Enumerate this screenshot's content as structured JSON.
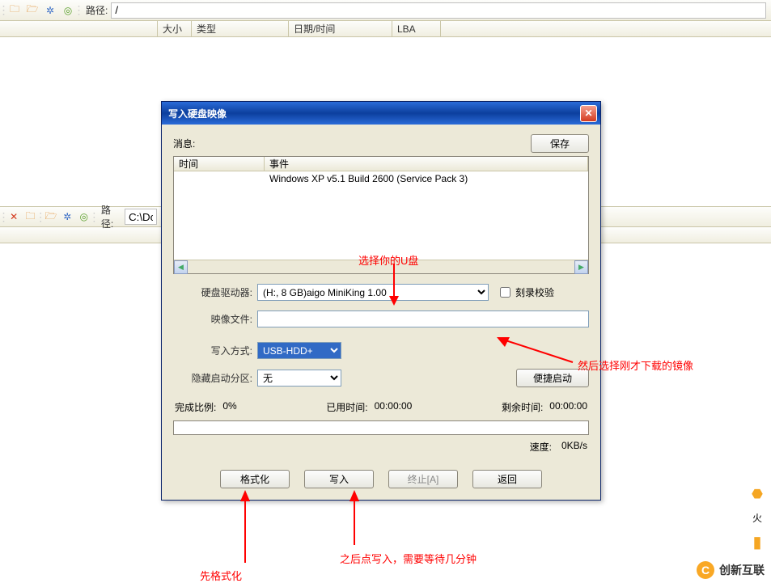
{
  "toolbar_top": {
    "path_label": "路径:",
    "path_value": "/"
  },
  "columns": {
    "c1_width": 195,
    "c1": "",
    "c2": "大小",
    "c3": "类型",
    "c4": "日期/时间",
    "c5": "LBA"
  },
  "toolbar2": {
    "path_label": "路径:",
    "path_value": "C:\\Doc"
  },
  "dialog": {
    "title": "写入硬盘映像",
    "msg_label": "消息:",
    "save_btn": "保存",
    "msg_cols": {
      "time": "时间",
      "event": "事件"
    },
    "msg_event": "Windows XP v5.1 Build 2600 (Service Pack 3)",
    "drive_label": "硬盘驱动器:",
    "drive_value": "(H:, 8 GB)aigo      MiniKing       1.00",
    "verify_label": "刻录校验",
    "image_label": "映像文件:",
    "image_value": "",
    "write_mode_label": "写入方式:",
    "write_mode_value": "USB-HDD+",
    "hidden_boot_label": "隐藏启动分区:",
    "hidden_boot_value": "无",
    "quick_boot_btn": "便捷启动",
    "percent_label": "完成比例:",
    "percent_value": "0%",
    "elapsed_label": "已用时间:",
    "elapsed_value": "00:00:00",
    "remaining_label": "剩余时间:",
    "remaining_value": "00:00:00",
    "speed_label": "速度:",
    "speed_value": "0KB/s",
    "format_btn": "格式化",
    "write_btn": "写入",
    "stop_btn": "终止[A]",
    "back_btn": "返回"
  },
  "annotations": {
    "a1": "选择你的U盘",
    "a2": "然后选择刚才下载的镜像",
    "a3": "先格式化",
    "a4": "之后点写入，需要等待几分钟"
  },
  "watermark": {
    "text": "创新互联",
    "side": "火"
  }
}
